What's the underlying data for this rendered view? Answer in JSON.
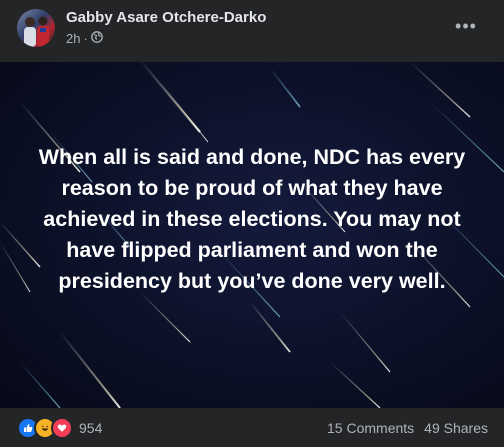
{
  "post": {
    "author": "Gabby Asare Otchere-Darko",
    "time": "2h",
    "separator": "·",
    "privacy_icon": "globe-icon",
    "more_icon": "•••",
    "text": "When all is said and done, NDC has every reason to be proud of what they have achieved in these elections. You may not have flipped parliament and won the presidency but you’ve done very well.",
    "background_color": "#0c1128"
  },
  "footer": {
    "reactions": [
      "like",
      "haha",
      "love"
    ],
    "reaction_count": "954",
    "comments": "15 Comments",
    "shares": "49 Shares"
  }
}
